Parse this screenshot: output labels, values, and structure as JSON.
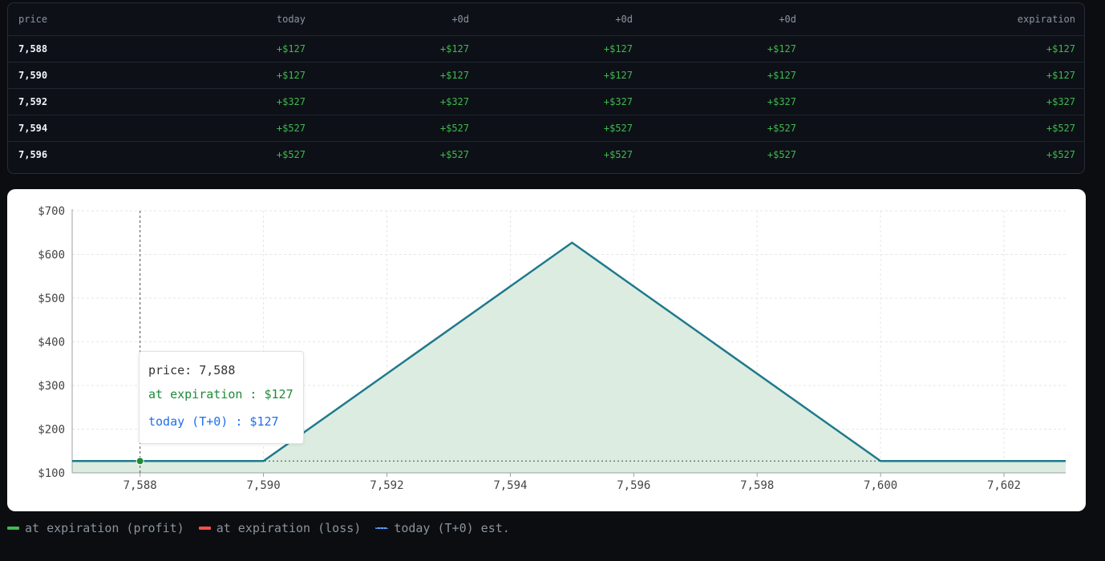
{
  "table": {
    "headers": [
      "price",
      "today",
      "+0d",
      "+0d",
      "+0d",
      "expiration"
    ],
    "rows": [
      [
        "7,588",
        "+$127",
        "+$127",
        "+$127",
        "+$127",
        "+$127"
      ],
      [
        "7,590",
        "+$127",
        "+$127",
        "+$127",
        "+$127",
        "+$127"
      ],
      [
        "7,592",
        "+$327",
        "+$327",
        "+$327",
        "+$327",
        "+$327"
      ],
      [
        "7,594",
        "+$527",
        "+$527",
        "+$527",
        "+$527",
        "+$527"
      ],
      [
        "7,596",
        "+$527",
        "+$527",
        "+$527",
        "+$527",
        "+$527"
      ]
    ]
  },
  "chart_data": {
    "type": "area",
    "x_ticks": [
      7588,
      7590,
      7592,
      7594,
      7596,
      7598,
      7600,
      7602
    ],
    "y_ticks": [
      100,
      200,
      300,
      400,
      500,
      600,
      700
    ],
    "xlim": [
      7586.9,
      7603.0
    ],
    "ylim": [
      100,
      700
    ],
    "grid": true,
    "series": [
      {
        "name": "at expiration",
        "x": [
          7586.9,
          7590,
          7595,
          7600,
          7603
        ],
        "y": [
          127,
          127,
          627,
          127,
          127
        ],
        "color": "#1f7a8c",
        "fill": "#dcece0"
      }
    ],
    "today_line_value": 127,
    "cursor_x": 7588,
    "cursor_value": 127,
    "tooltip": {
      "price": "price: 7,588",
      "expiration": "at expiration : $127",
      "today": "today (T+0) : $127"
    }
  },
  "legend": [
    {
      "label": "at expiration (profit)",
      "color": "#3fb950",
      "style": "solid"
    },
    {
      "label": "at expiration (loss)",
      "color": "#f85149",
      "style": "solid"
    },
    {
      "label": "today (T+0) est.",
      "color": "#58a6ff",
      "style": "dotted"
    }
  ]
}
